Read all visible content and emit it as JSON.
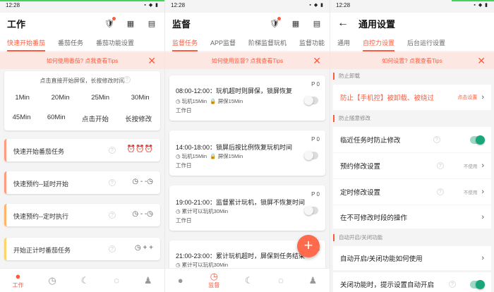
{
  "status_time": "12:28",
  "panel1": {
    "title": "工作",
    "tabs": [
      "快速开始番茄",
      "番茄任务",
      "番茄功能设置"
    ],
    "tip": "如何使用番茄? 点我查看Tips",
    "quick_hint": "点击直接开始屏保，长按修改时间",
    "quick_times": [
      "1Min",
      "20Min",
      "25Min",
      "30Min",
      "45Min",
      "60Min",
      "点击开始",
      "长按修改"
    ],
    "items": [
      {
        "label": "快速开始番茄任务",
        "icons": "⏰⏰⏰"
      },
      {
        "label": "快速预约--延时开始",
        "icons": "◷ - -◷"
      },
      {
        "label": "快速预约--定时执行",
        "icons": "◷ - -◷"
      },
      {
        "label": "开始正计时番茄任务",
        "icons": "◷ +  +"
      }
    ],
    "nav": [
      "工作"
    ]
  },
  "panel2": {
    "title": "监督",
    "tabs": [
      "监督任务",
      "APP监督",
      "阶梯监督玩机",
      "监督功能"
    ],
    "tip": "如何使用监督? 点我查看Tips",
    "tasks": [
      {
        "title": "08:00-12:00：玩机超时则屏保，锁屏恢复",
        "p": "P 0",
        "meta1": "玩机15Min",
        "meta2": "屏保15Min",
        "sub": "工作日"
      },
      {
        "title": "14:00-18:00：锁屏后按比例恢复玩机时间",
        "p": "P 0",
        "meta1": "玩机15Min",
        "meta2": "屏保15Min",
        "sub": "工作日"
      },
      {
        "title": "19:00-21:00：监督累计玩机，锁屏不恢复时间",
        "p": "P 0",
        "meta1": "累计可以玩机30Min",
        "meta2": "",
        "sub": "工作日"
      },
      {
        "title": "21:00-23:00：累计玩机超时，屏保到任务结束",
        "p": "P 0",
        "meta1": "累计可以玩机30Min",
        "meta2": "",
        "sub": ""
      }
    ],
    "nav": [
      "监督"
    ]
  },
  "panel3": {
    "title": "通用设置",
    "tabs": [
      "通用",
      "自控力设置",
      "后台运行设置"
    ],
    "tip": "如何设置? 点我查看Tips",
    "sec1": "防止卸载",
    "uninstall_label": "防止【手机控】被卸载、被绕过",
    "uninstall_action": "点击设置",
    "sec2": "防止随意修改",
    "rows": [
      {
        "label": "临近任务时防止修改",
        "right": ""
      },
      {
        "label": "预约修改设置",
        "right": "不使用"
      },
      {
        "label": "定时修改设置",
        "right": "不使用"
      },
      {
        "label": "在不可修改时段的操作",
        "right": ""
      }
    ],
    "sec3": "自动开启/关闭功能",
    "rows2": [
      {
        "label": "自动开启/关闭功能如何使用"
      },
      {
        "label": "关闭功能时，提示设置自动开启"
      }
    ]
  },
  "colors": {
    "accent": "#ff5a3c",
    "green": "#1aa57a"
  }
}
